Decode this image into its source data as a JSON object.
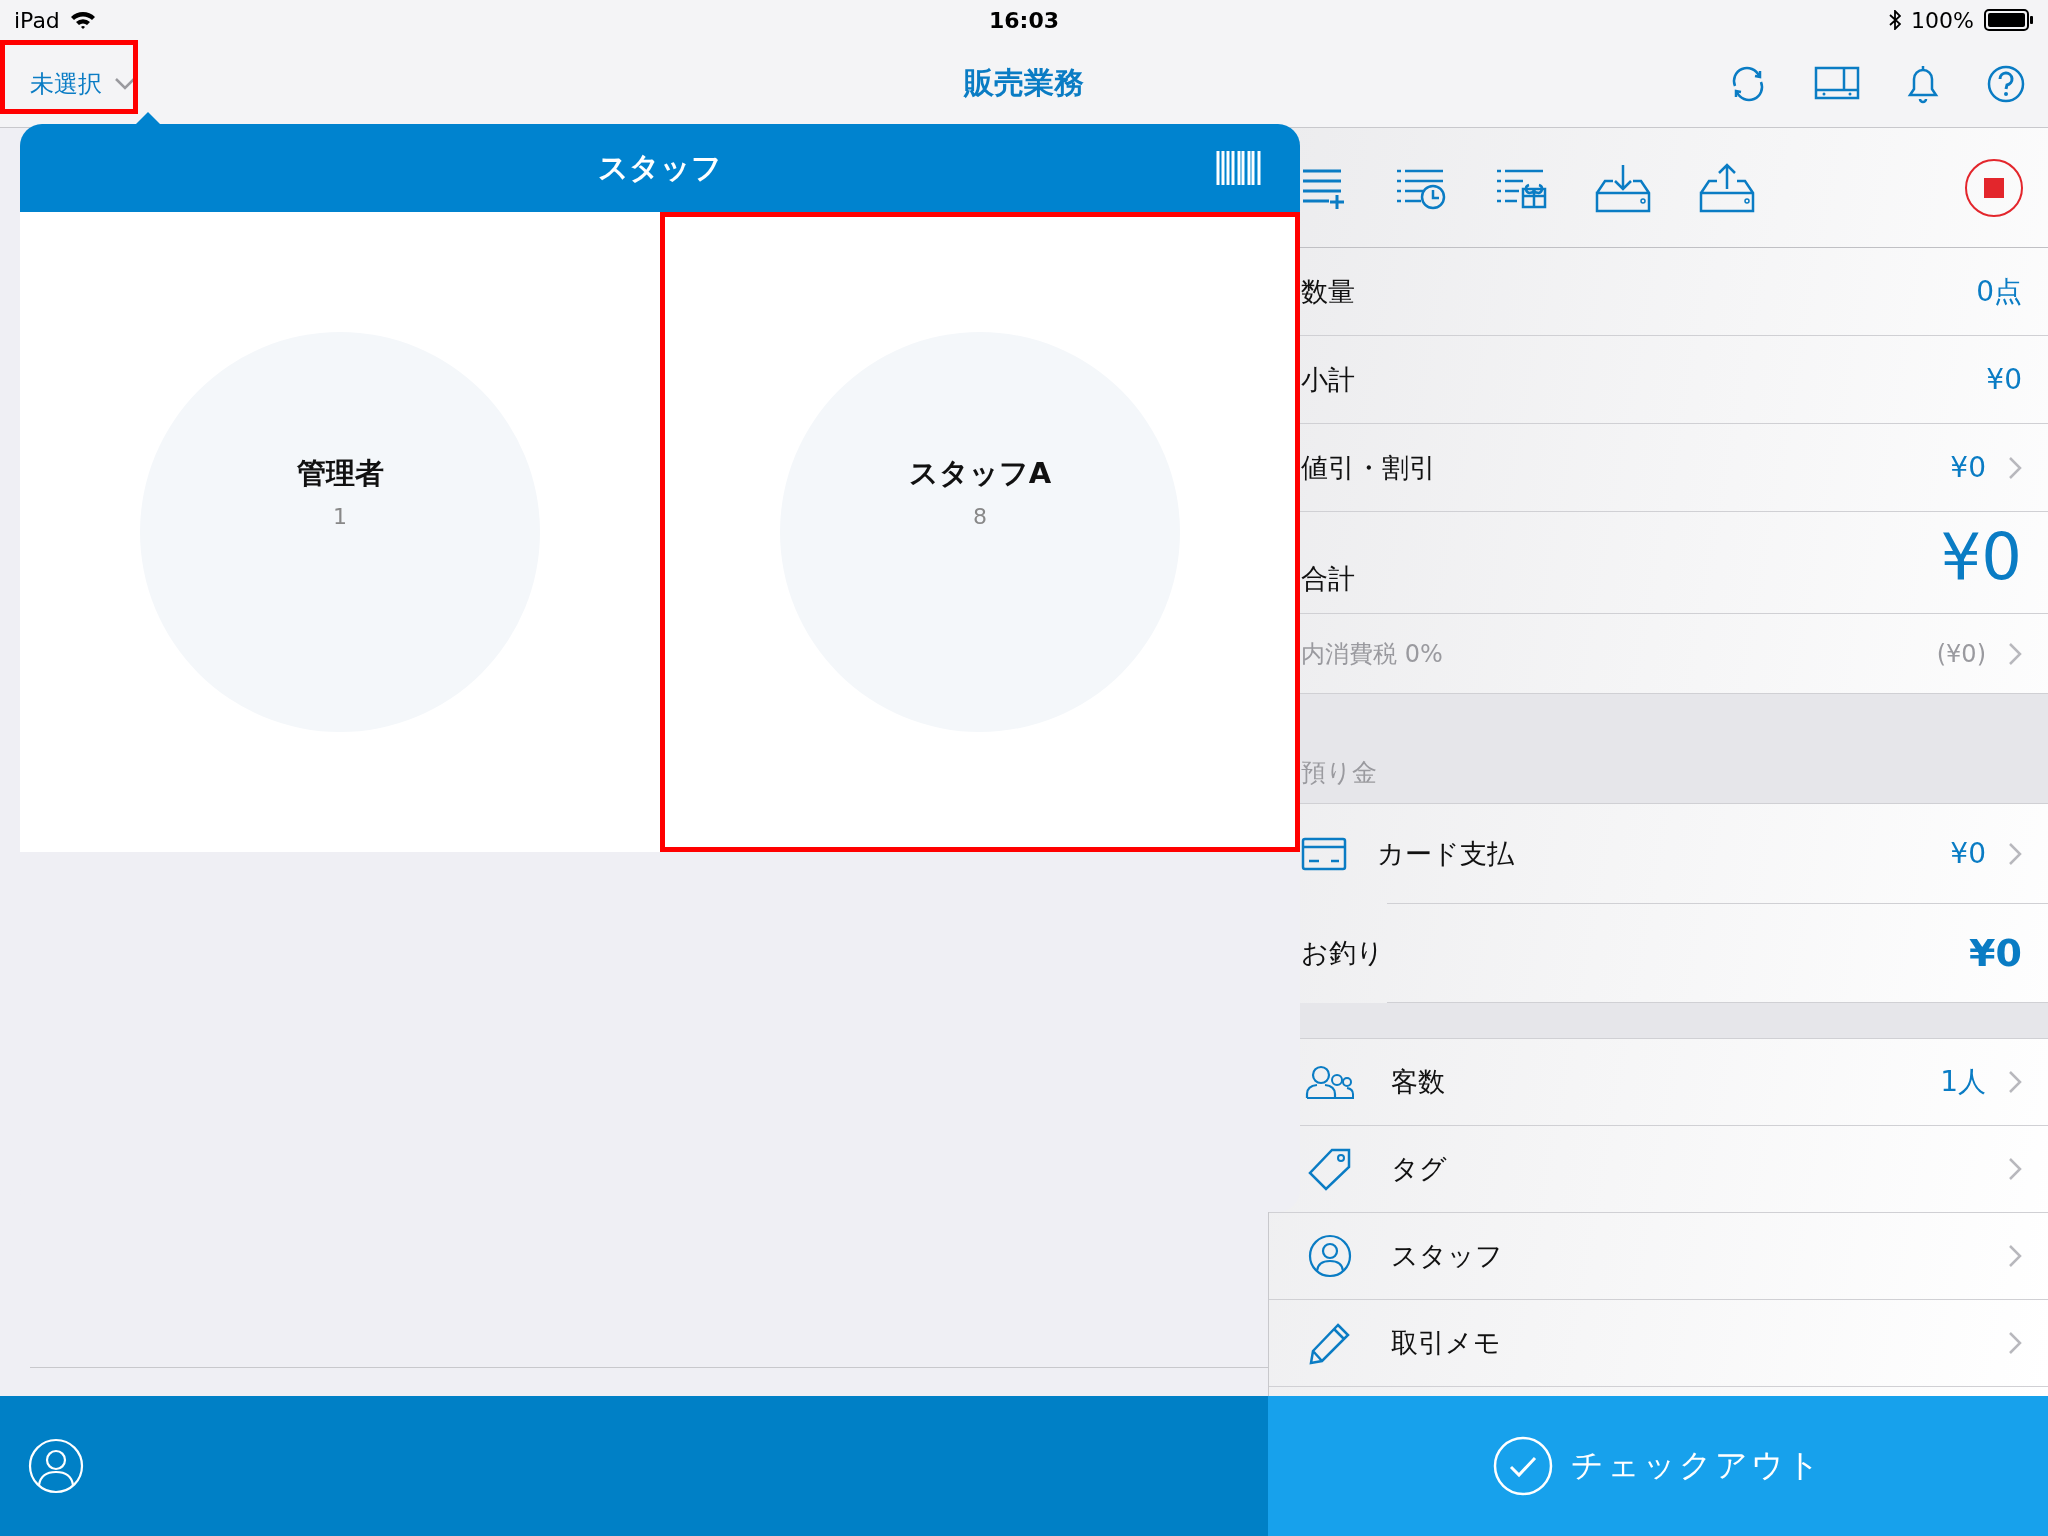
{
  "status_bar": {
    "device": "iPad",
    "time": "16:03",
    "battery": "100%"
  },
  "nav": {
    "staff_selector": {
      "label": "未選択",
      "highlighted": true
    },
    "title": "販売業務"
  },
  "summary": [
    {
      "label": "数量",
      "value": "0点",
      "chevron": false
    },
    {
      "label": "小計",
      "value": "¥0",
      "chevron": false
    },
    {
      "label": "値引・割引",
      "value": "¥0",
      "chevron": true
    }
  ],
  "total": {
    "label": "合計",
    "value": "¥0"
  },
  "tax": {
    "label": "内消費税 0%",
    "value": "(¥0)",
    "chevron": true
  },
  "deposit": {
    "label": "預り金",
    "payments": [
      {
        "label": "カード支払",
        "value": "¥0",
        "chevron": true
      }
    ]
  },
  "change": {
    "label": "お釣り",
    "value": "¥0"
  },
  "options": [
    {
      "label": "客数",
      "value": "1人",
      "chevron": true
    },
    {
      "label": "タグ",
      "chevron": true
    },
    {
      "label": "スタッフ",
      "chevron": true
    },
    {
      "label": "取引メモ",
      "chevron": true
    }
  ],
  "popover": {
    "title": "スタッフ",
    "staff": [
      {
        "name": "管理者",
        "code": "1",
        "highlighted": false
      },
      {
        "name": "スタッフA",
        "code": "8",
        "highlighted": true
      }
    ]
  },
  "checkout": {
    "label": "チェックアウト"
  }
}
